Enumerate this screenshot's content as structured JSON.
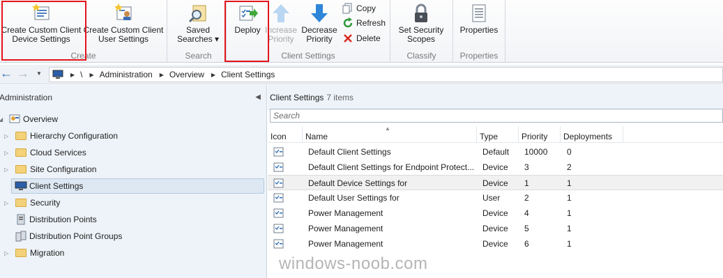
{
  "ribbon": {
    "create": {
      "group_label": "Create",
      "device_btn": [
        "Create Custom Client",
        "Device Settings"
      ],
      "user_btn": [
        "Create Custom Client",
        "User Settings"
      ]
    },
    "search": {
      "group_label": "Search",
      "saved_searches": [
        "Saved",
        "Searches ▾"
      ]
    },
    "client_settings": {
      "group_label": "Client Settings",
      "deploy": "Deploy",
      "increase": [
        "Increase",
        "Priority"
      ],
      "decrease": [
        "Decrease",
        "Priority"
      ],
      "copy": "Copy",
      "refresh": "Refresh",
      "delete": "Delete"
    },
    "classify": {
      "group_label": "Classify",
      "security_scopes": [
        "Set Security",
        "Scopes"
      ]
    },
    "properties": {
      "group_label": "Properties",
      "properties_btn": "Properties"
    }
  },
  "address_bar": {
    "root": "\\",
    "crumbs": [
      "Administration",
      "Overview",
      "Client Settings"
    ]
  },
  "nav": {
    "header": "Administration",
    "items": [
      {
        "label": "Overview",
        "icon": "overview-icon",
        "expander": "expanded"
      },
      {
        "label": "Hierarchy Configuration",
        "icon": "folder-icon",
        "expander": "collapsed"
      },
      {
        "label": "Cloud Services",
        "icon": "folder-icon",
        "expander": "collapsed"
      },
      {
        "label": "Site Configuration",
        "icon": "folder-icon",
        "expander": "collapsed"
      },
      {
        "label": "Client Settings",
        "icon": "client-settings-icon",
        "expander": "none",
        "selected": true
      },
      {
        "label": "Security",
        "icon": "folder-icon",
        "expander": "collapsed"
      },
      {
        "label": "Distribution Points",
        "icon": "distribution-points-icon",
        "expander": "none"
      },
      {
        "label": "Distribution Point Groups",
        "icon": "distribution-point-groups-icon",
        "expander": "none"
      },
      {
        "label": "Migration",
        "icon": "folder-icon",
        "expander": "collapsed"
      }
    ]
  },
  "main": {
    "title": "Client Settings",
    "count": "7 items",
    "search_placeholder": "Search",
    "columns": [
      "Icon",
      "Name",
      "Type",
      "Priority",
      "Deployments"
    ],
    "rows": [
      {
        "name": "Default Client Settings",
        "type": "Default",
        "priority": "10000",
        "deployments": "0"
      },
      {
        "name": "Default Client Settings for Endpoint Protect...",
        "type": "Device",
        "priority": "3",
        "deployments": "2"
      },
      {
        "name": "Default Device Settings for",
        "type": "Device",
        "priority": "1",
        "deployments": "1",
        "selected": true
      },
      {
        "name": "Default User Settings for",
        "type": "User",
        "priority": "2",
        "deployments": "1"
      },
      {
        "name": "Power Management",
        "type": "Device",
        "priority": "4",
        "deployments": "1"
      },
      {
        "name": "Power Management",
        "type": "Device",
        "priority": "5",
        "deployments": "1"
      },
      {
        "name": "Power Management",
        "type": "Device",
        "priority": "6",
        "deployments": "1"
      }
    ]
  },
  "watermark": "windows-noob.com",
  "colors": {
    "highlight_box": "#e3141b",
    "selection": "#dde8f3"
  }
}
